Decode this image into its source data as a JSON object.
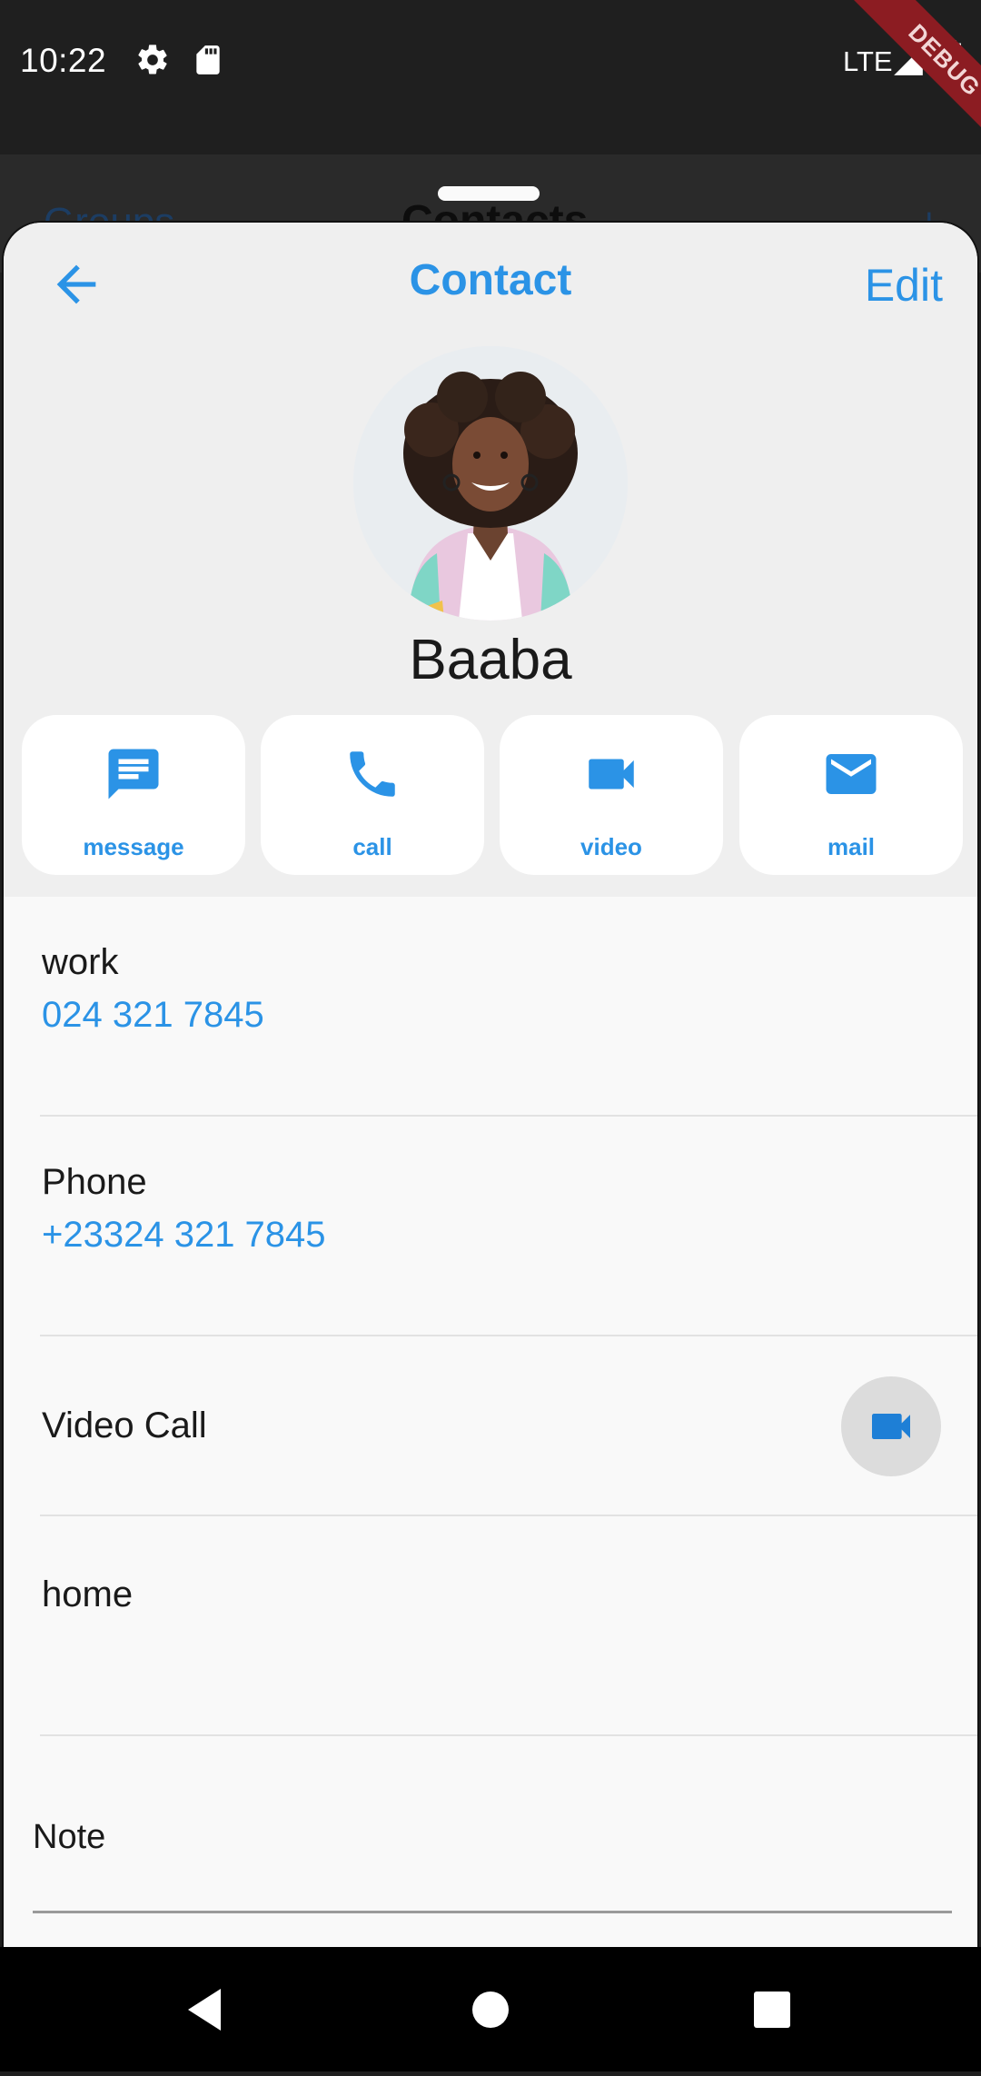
{
  "status_bar": {
    "time": "10:22",
    "network": "LTE",
    "debug_banner": "DEBUG"
  },
  "background_page": {
    "left": "Groups",
    "title": "Contacts",
    "right": "+"
  },
  "header": {
    "title": "Contact",
    "edit_label": "Edit"
  },
  "contact": {
    "name": "Baaba"
  },
  "actions": [
    {
      "label": "message",
      "icon": "message-icon"
    },
    {
      "label": "call",
      "icon": "phone-icon"
    },
    {
      "label": "video",
      "icon": "videocam-icon"
    },
    {
      "label": "mail",
      "icon": "mail-icon"
    }
  ],
  "details": [
    {
      "label": "work",
      "value": "024 321 7845"
    },
    {
      "label": "Phone",
      "value": "+23324 321 7845"
    },
    {
      "label": "Video Call",
      "value": ""
    },
    {
      "label": "home",
      "value": ""
    }
  ],
  "note": {
    "label": "Note"
  },
  "colors": {
    "accent": "#2b93e6",
    "sheet_bg": "#f9f9f9",
    "header_bg": "#efefef",
    "status_bar": "#1f1f1f",
    "nav_bar": "#000000"
  }
}
